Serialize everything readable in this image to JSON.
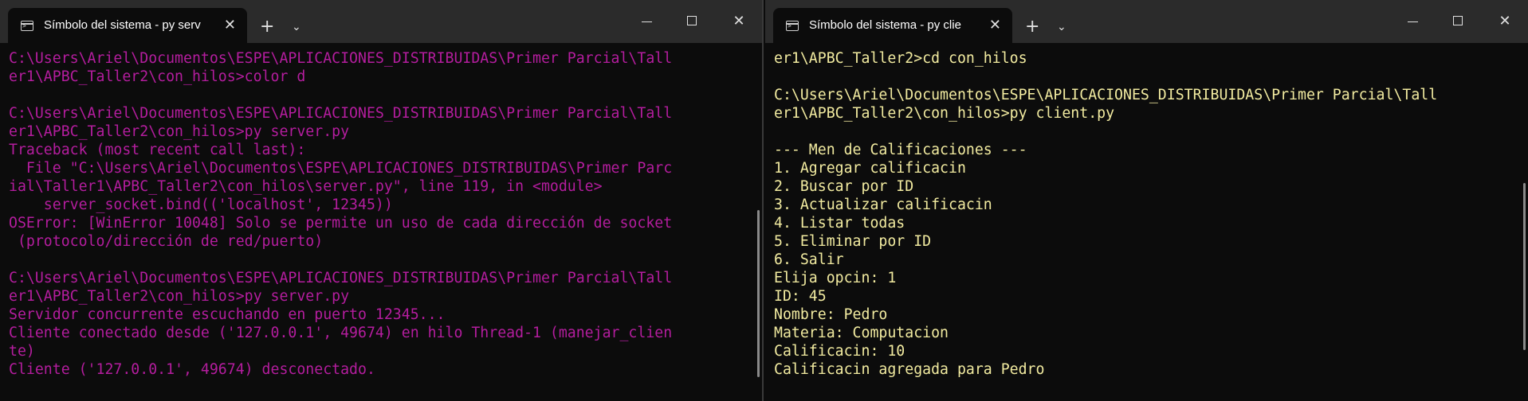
{
  "left_window": {
    "tab_title": "Símbolo del sistema - py  serv",
    "tab_close": "✕",
    "new_tab": "+",
    "dropdown": "⌄",
    "minimize": "",
    "maximize": "",
    "close": "✕",
    "lines": [
      "C:\\Users\\Ariel\\Documentos\\ESPE\\APLICACIONES_DISTRIBUIDAS\\Primer Parcial\\Tall",
      "er1\\APBC_Taller2\\con_hilos>color d",
      "",
      "C:\\Users\\Ariel\\Documentos\\ESPE\\APLICACIONES_DISTRIBUIDAS\\Primer Parcial\\Tall",
      "er1\\APBC_Taller2\\con_hilos>py server.py",
      "Traceback (most recent call last):",
      "  File \"C:\\Users\\Ariel\\Documentos\\ESPE\\APLICACIONES_DISTRIBUIDAS\\Primer Parc",
      "ial\\Taller1\\APBC_Taller2\\con_hilos\\server.py\", line 119, in <module>",
      "    server_socket.bind(('localhost', 12345))",
      "OSError: [WinError 10048] Solo se permite un uso de cada dirección de socket",
      " (protocolo/dirección de red/puerto)",
      "",
      "C:\\Users\\Ariel\\Documentos\\ESPE\\APLICACIONES_DISTRIBUIDAS\\Primer Parcial\\Tall",
      "er1\\APBC_Taller2\\con_hilos>py server.py",
      "Servidor concurrente escuchando en puerto 12345...",
      "Cliente conectado desde ('127.0.0.1', 49674) en hilo Thread-1 (manejar_clien",
      "te)",
      "Cliente ('127.0.0.1', 49674) desconectado."
    ]
  },
  "right_window": {
    "tab_title": "Símbolo del sistema - py  clie",
    "tab_close": "✕",
    "new_tab": "+",
    "dropdown": "⌄",
    "minimize": "",
    "maximize": "",
    "close": "✕",
    "lines": [
      "er1\\APBC_Taller2>cd con_hilos",
      "",
      "C:\\Users\\Ariel\\Documentos\\ESPE\\APLICACIONES_DISTRIBUIDAS\\Primer Parcial\\Tall",
      "er1\\APBC_Taller2\\con_hilos>py client.py",
      "",
      "--- Men de Calificaciones ---",
      "1. Agregar calificacin",
      "2. Buscar por ID",
      "3. Actualizar calificacin",
      "4. Listar todas",
      "5. Eliminar por ID",
      "6. Salir",
      "Elija opcin: 1",
      "ID: 45",
      "Nombre: Pedro",
      "Materia: Computacion",
      "Calificacin: 10",
      "Calificacin agregada para Pedro"
    ]
  },
  "colors": {
    "left_text": "#b41d9e",
    "right_text": "#f2eba0",
    "background": "#0c0c0c",
    "titlebar": "#2b2b2b"
  }
}
